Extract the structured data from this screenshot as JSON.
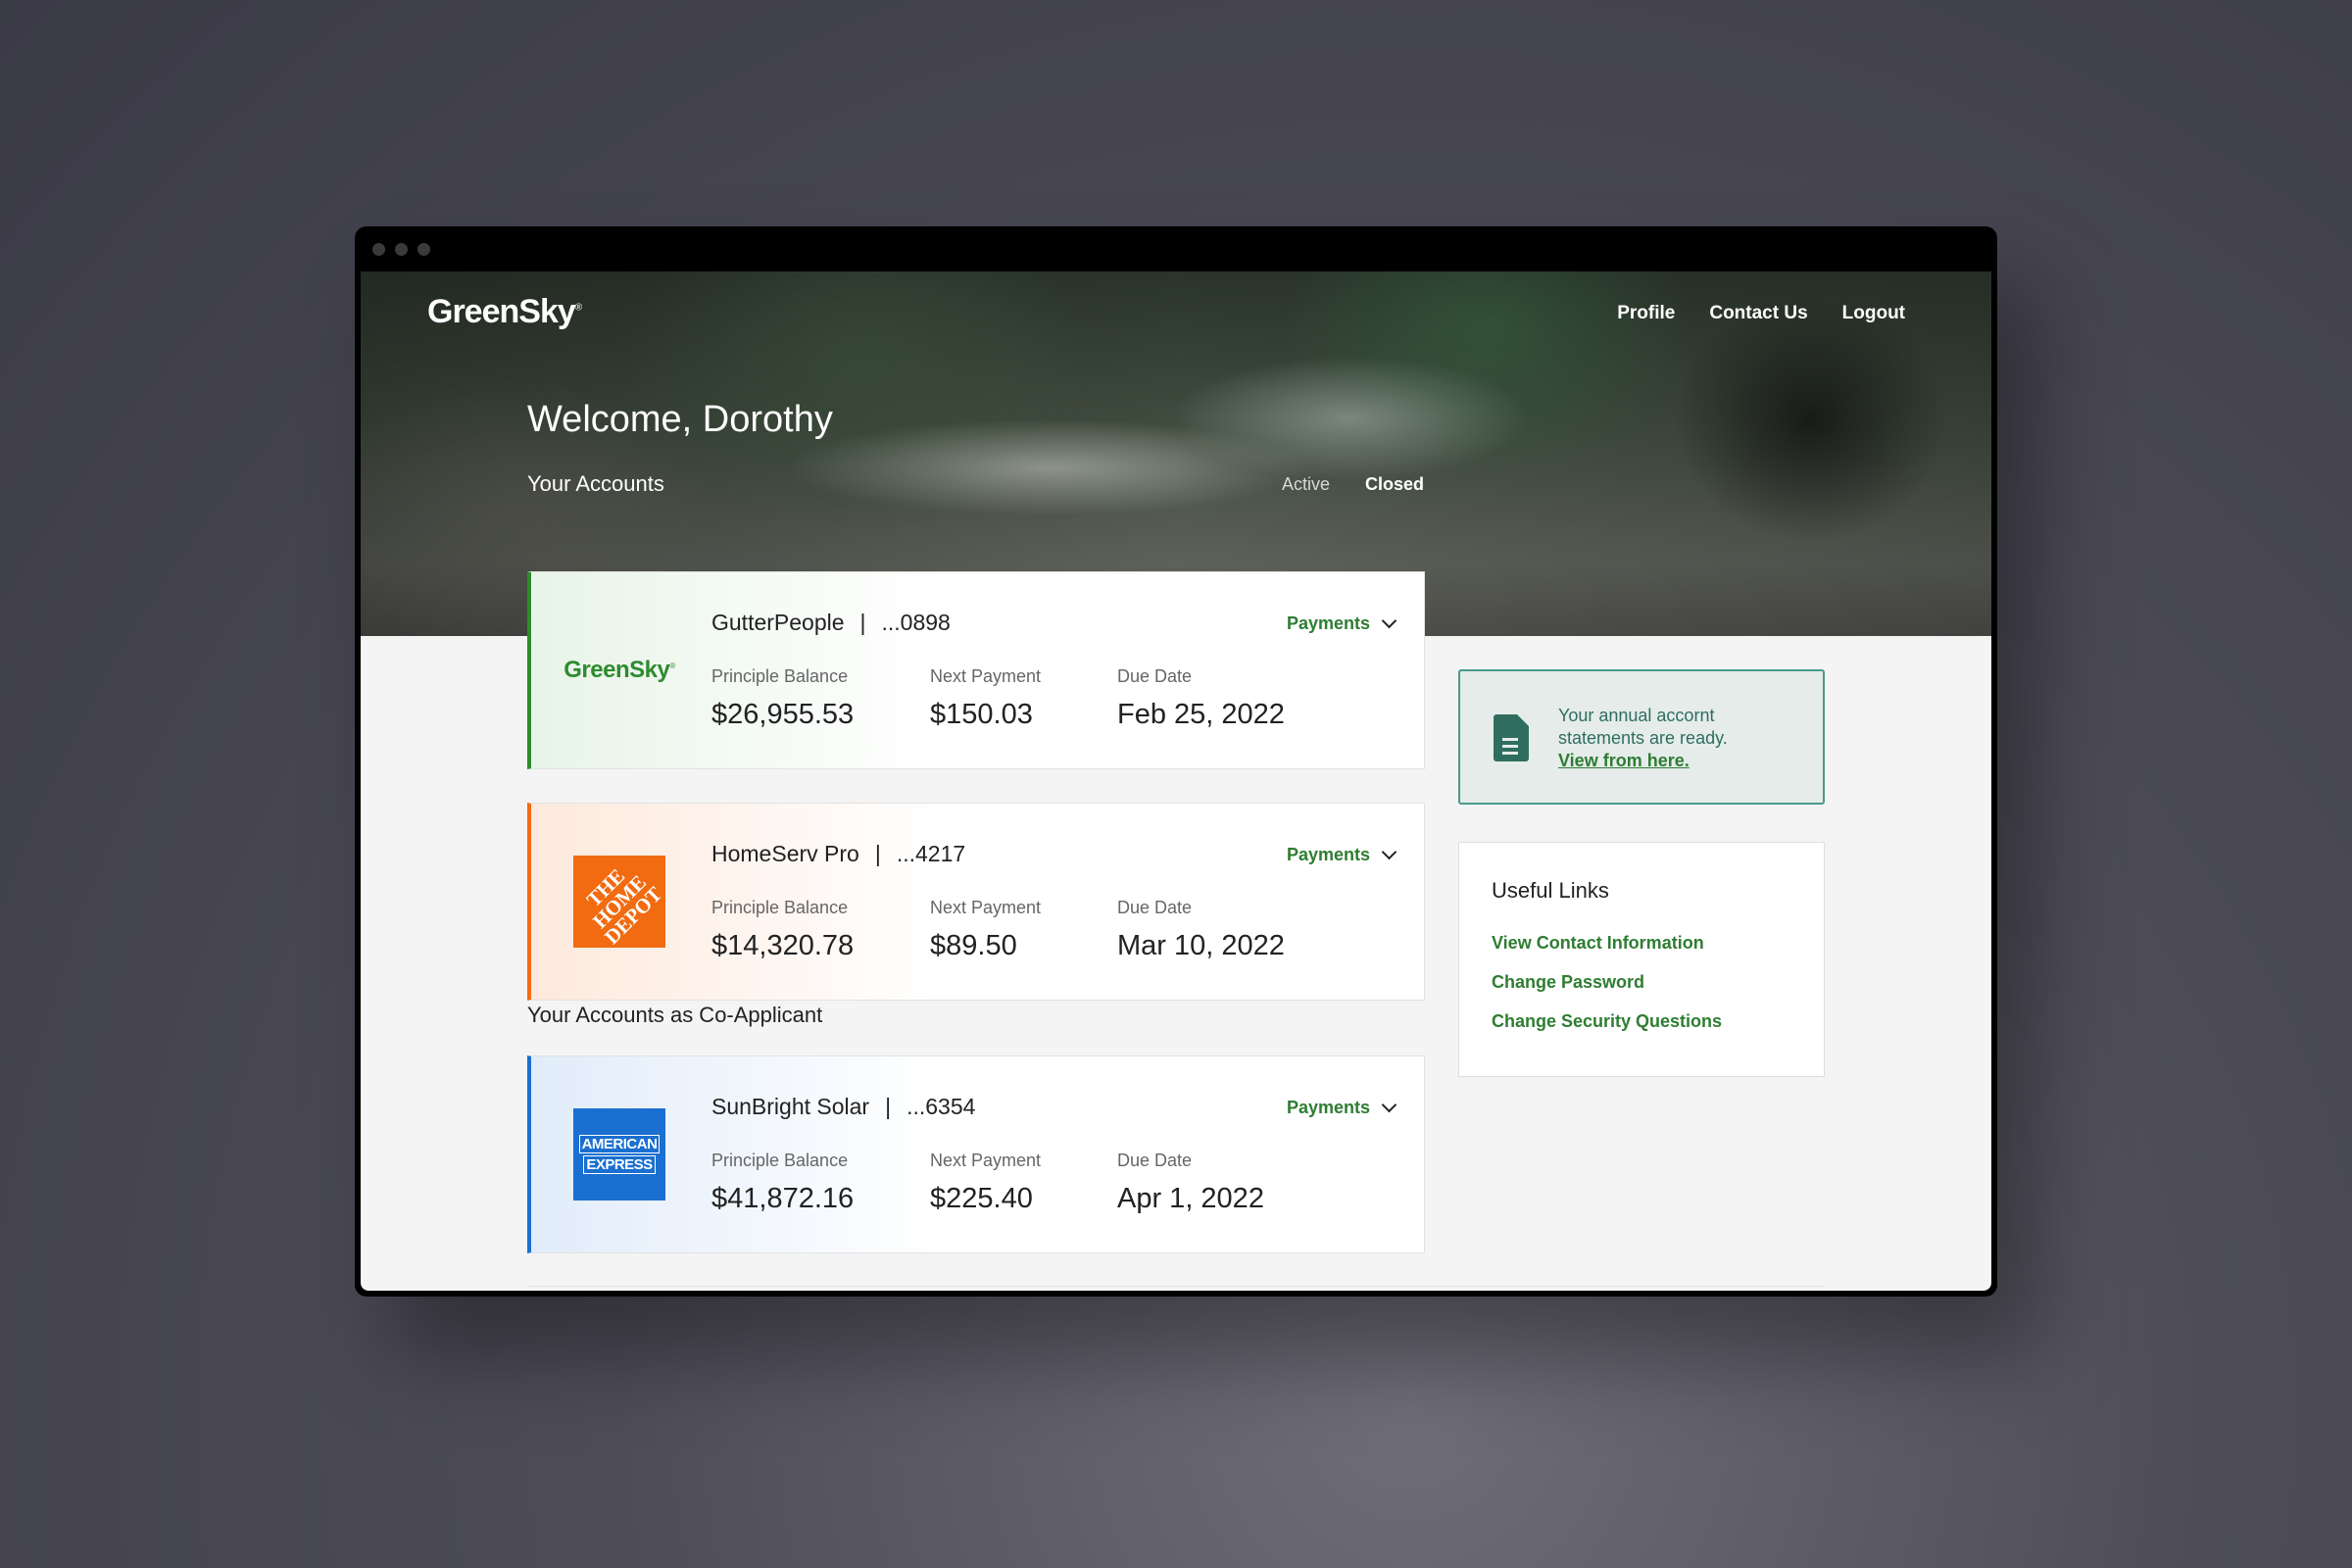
{
  "nav": {
    "logo": "GreenSky",
    "links": [
      "Profile",
      "Contact Us",
      "Logout"
    ]
  },
  "header": {
    "welcome": "Welcome, Dorothy",
    "section": "Your Accounts",
    "filters": [
      "Active",
      "Closed"
    ]
  },
  "accounts": [
    {
      "merchant": "GutterPeople",
      "number": "...0898",
      "logo": "GreenSky",
      "payments_label": "Payments",
      "labels": [
        "Principle Balance",
        "Next Payment",
        "Due Date"
      ],
      "values": [
        "$26,955.53",
        "$150.03",
        "Feb 25, 2022"
      ]
    },
    {
      "merchant": "HomeServ Pro",
      "number": "...4217",
      "logo": "THE HOME DEPOT",
      "payments_label": "Payments",
      "labels": [
        "Principle Balance",
        "Next Payment",
        "Due Date"
      ],
      "values": [
        "$14,320.78",
        "$89.50",
        "Mar 10, 2022"
      ]
    }
  ],
  "co_applicant": {
    "title": "Your Accounts as Co-Applicant",
    "accounts": [
      {
        "merchant": "SunBright Solar",
        "number": "...6354",
        "logo": [
          "AMERICAN",
          "EXPRESS"
        ],
        "payments_label": "Payments",
        "labels": [
          "Principle Balance",
          "Next Payment",
          "Due Date"
        ],
        "values": [
          "$41,872.16",
          "$225.40",
          "Apr 1, 2022"
        ]
      }
    ]
  },
  "notice": {
    "line1": "Your annual accornt",
    "line2": "statements are ready.",
    "link": "View from here."
  },
  "useful_links": {
    "title": "Useful Links",
    "items": [
      "View Contact Information",
      "Change Password",
      "Change Security Questions"
    ]
  },
  "colors": {
    "brand_green": "#2e7d32",
    "home_depot_orange": "#f26b10",
    "amex_blue": "#1a6fd0",
    "notice_border": "#4a9b8a"
  },
  "icons": {
    "chevron": "chevron-down-icon",
    "document": "document-icon"
  }
}
